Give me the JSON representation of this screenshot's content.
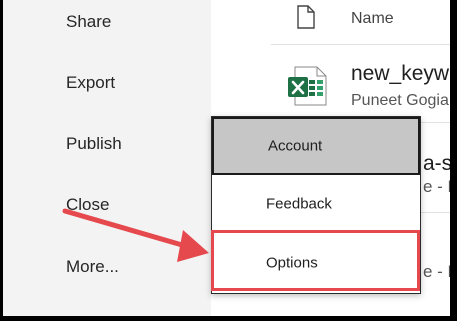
{
  "sidebar": {
    "items": [
      {
        "label": "Share"
      },
      {
        "label": "Export"
      },
      {
        "label": "Publish"
      },
      {
        "label": "Close"
      },
      {
        "label": "More..."
      }
    ]
  },
  "file_list": {
    "header": {
      "name_label": "Name",
      "icon": "document-icon"
    },
    "files": [
      {
        "name": "new_keyw",
        "author": "Puneet Gogia",
        "icon": "excel-icon"
      }
    ],
    "partial_text": {
      "row2_name": "a-sh",
      "row2_author": "e - P",
      "row3_author": "e - P"
    }
  },
  "menu": {
    "items": [
      {
        "label": "Account",
        "selected": true
      },
      {
        "label": "Feedback",
        "selected": false
      },
      {
        "label": "Options",
        "selected": false,
        "highlighted": true
      }
    ]
  },
  "annotation": {
    "arrow_color": "#e5484d",
    "highlight_color": "#e5484d"
  },
  "colors": {
    "sidebar_bg": "#f3f3f3",
    "excel_green": "#1e7145",
    "selected_bg": "#c6c6c6"
  }
}
